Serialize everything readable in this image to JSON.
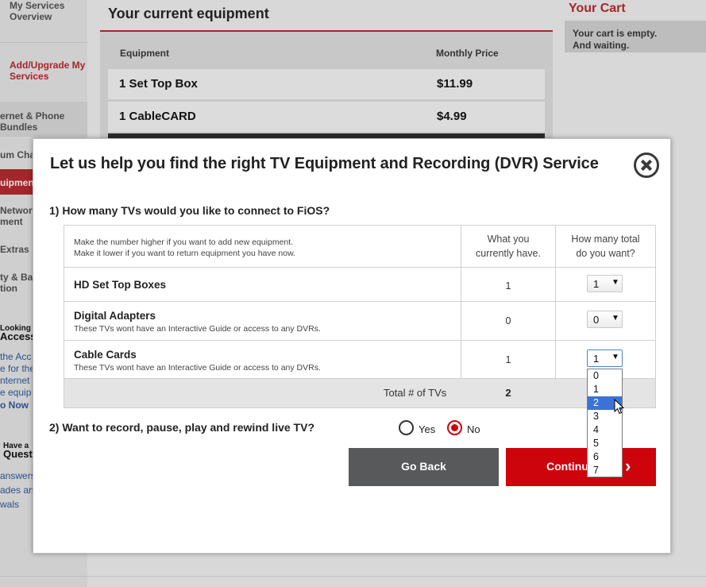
{
  "background": {
    "sidebar": {
      "my_services_overview": "My Services Overview",
      "add_upgrade": "Add/Upgrade My Services",
      "internet_phone": "ernet & Phone Bundles",
      "premium_channels": "um Chan",
      "equipment": "uipment",
      "network": "Network",
      "network_2": "ment",
      "extras": "Extras",
      "backup": "ty & Bac",
      "backup_2": "tion",
      "looking_for": "Looking fo",
      "access": "Access",
      "access_text_1": "the Acc",
      "access_text_2": "e for the",
      "access_text_3": "nternet a",
      "access_text_4": "e equip",
      "go_now": "o Now",
      "have_a": "Have a",
      "question": "Quest",
      "link_1": "answers",
      "link_2": "ades and",
      "link_3": "wals"
    },
    "main": {
      "title": "Your current equipment",
      "col_equipment": "Equipment",
      "col_price": "Monthly Price",
      "rows": [
        {
          "name": "1 Set Top Box",
          "price": "$11.99"
        },
        {
          "name": "1 CableCARD",
          "price": "$4.99"
        }
      ]
    },
    "cart": {
      "title": "Your Cart",
      "line_1": "Your cart is empty.",
      "line_2": "And waiting."
    }
  },
  "modal": {
    "title": "Let us help you find the right TV Equipment and Recording (DVR) Service",
    "question_1": "1) How many TVs would you like to connect to FiOS?",
    "header_note_1": "Make the number higher if you want to add new equipment.",
    "header_note_2": "Make it lower if you want to return equipment you have now.",
    "header_current_1": "What you",
    "header_current_2": "currently have.",
    "header_total_1": "How many total",
    "header_total_2": "do you want?",
    "rows": [
      {
        "name": "HD Set Top Boxes",
        "subtitle": "",
        "current": "1",
        "selected": "1"
      },
      {
        "name": "Digital Adapters",
        "subtitle": "These TVs wont have an Interactive Guide or access to any DVRs.",
        "current": "0",
        "selected": "0"
      },
      {
        "name": "Cable Cards",
        "subtitle": "These TVs wont have an Interactive Guide or access to any DVRs.",
        "current": "1",
        "selected": "1"
      }
    ],
    "total_label": "Total # of TVs",
    "total_value": "2",
    "dropdown_options": [
      "0",
      "1",
      "2",
      "3",
      "4",
      "5",
      "6",
      "7"
    ],
    "dropdown_highlighted": "2",
    "question_2": "2) Want to record, pause, play and rewind live TV?",
    "radio_yes": "Yes",
    "radio_no": "No",
    "radio_selected": "No",
    "go_back_label": "Go Back",
    "continue_label": "Continu",
    "continue_chevron": "›"
  },
  "colors": {
    "accent_red": "#cd040b",
    "dark_gray": "#58595b",
    "selection_blue": "#3b73d4"
  }
}
